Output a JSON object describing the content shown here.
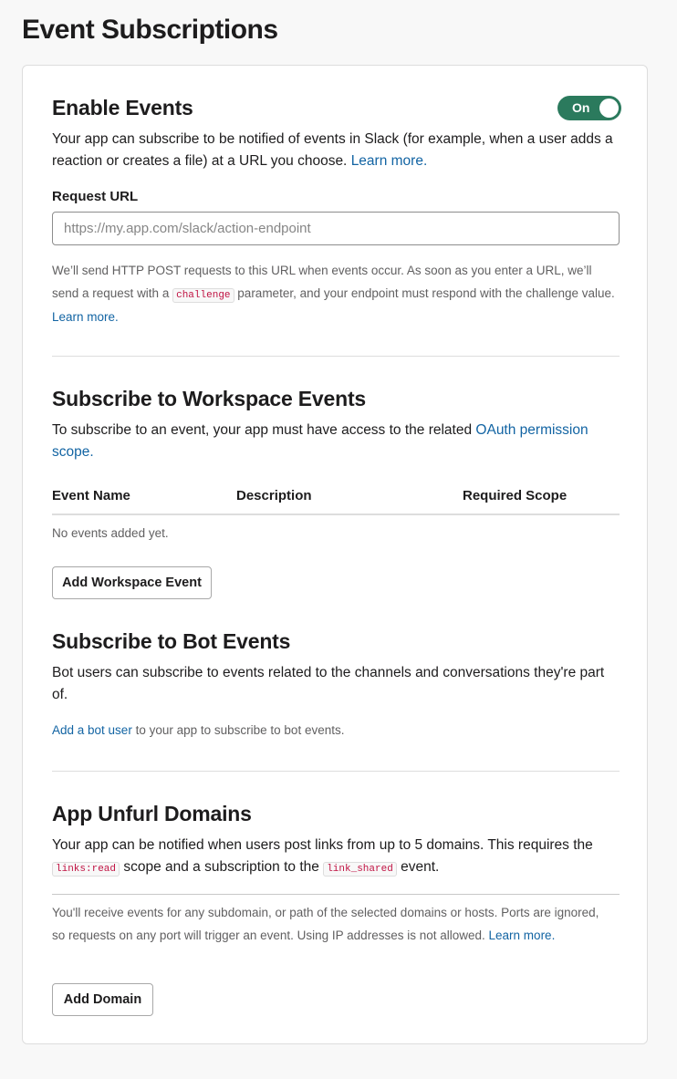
{
  "page": {
    "title": "Event Subscriptions"
  },
  "enable_events": {
    "title": "Enable Events",
    "toggle_label": "On",
    "description": "Your app can subscribe to be notified of events in Slack (for example, when a user adds a reaction or creates a file) at a URL you choose.",
    "learn_more": "Learn more.",
    "request_url_label": "Request URL",
    "request_url_value": "",
    "request_url_placeholder": "https://my.app.com/slack/action-endpoint",
    "help_part1": "We’ll send HTTP POST requests to this URL when events occur. As soon as you enter a URL, we’ll send a request with a",
    "help_code": "challenge",
    "help_part2": "parameter, and your endpoint must respond with the challenge value.",
    "help_learn_more": "Learn more."
  },
  "workspace_events": {
    "title": "Subscribe to Workspace Events",
    "description": "To subscribe to an event, your app must have access to the related",
    "oauth_link": "OAuth permission scope.",
    "columns": [
      "Event Name",
      "Description",
      "Required Scope"
    ],
    "empty_text": "No events added yet.",
    "add_button": "Add Workspace Event"
  },
  "bot_events": {
    "title": "Subscribe to Bot Events",
    "description": "Bot users can subscribe to events related to the channels and conversations they're part of.",
    "add_bot_link": "Add a bot user",
    "add_bot_suffix": "to your app to subscribe to bot events."
  },
  "unfurl": {
    "title": "App Unfurl Domains",
    "desc_part1": "Your app can be notified when users post links from up to 5 domains. This requires the",
    "scope_code": "links:read",
    "desc_part2": "scope and a subscription to the",
    "event_code": "link_shared",
    "desc_part3": "event.",
    "note": "You'll receive events for any subdomain, or path of the selected domains or hosts. Ports are ignored, so requests on any port will trigger an event. Using IP addresses is not allowed.",
    "note_learn_more": "Learn more.",
    "add_button": "Add Domain"
  },
  "colors": {
    "toggle_on": "#2b7a5d",
    "link": "#1264a3",
    "code": "#c01343"
  }
}
